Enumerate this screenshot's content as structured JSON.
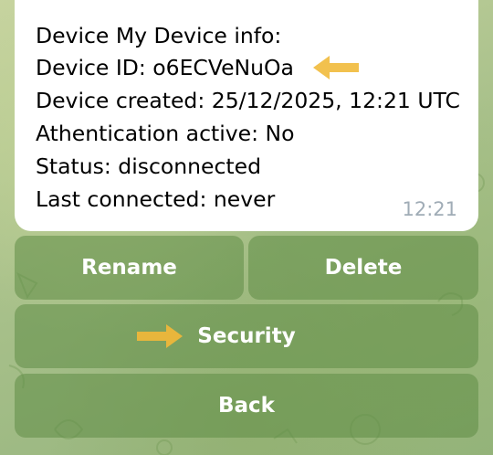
{
  "message": {
    "title_line": "Device My Device info:",
    "device_id_line": "Device ID: o6ECVeNuOa",
    "created_line": "Device created: 25/12/2025, 12:21 UTC",
    "auth_line": "Athentication active: No",
    "status_line": "Status: disconnected",
    "last_connected_line": "Last connected: never",
    "time": "12:21"
  },
  "keyboard": {
    "rename_label": "Rename",
    "delete_label": "Delete",
    "security_label": "Security",
    "back_label": "Back"
  },
  "colors": {
    "arrow": "#f2c14e",
    "bubble": "#ffffff",
    "button_fill": "rgba(95,140,70,0.55)",
    "timestamp": "#a0acb6"
  },
  "annotations": {
    "arrow_icon": "arrow-left-icon",
    "arrow_right_icon": "arrow-right-icon"
  }
}
